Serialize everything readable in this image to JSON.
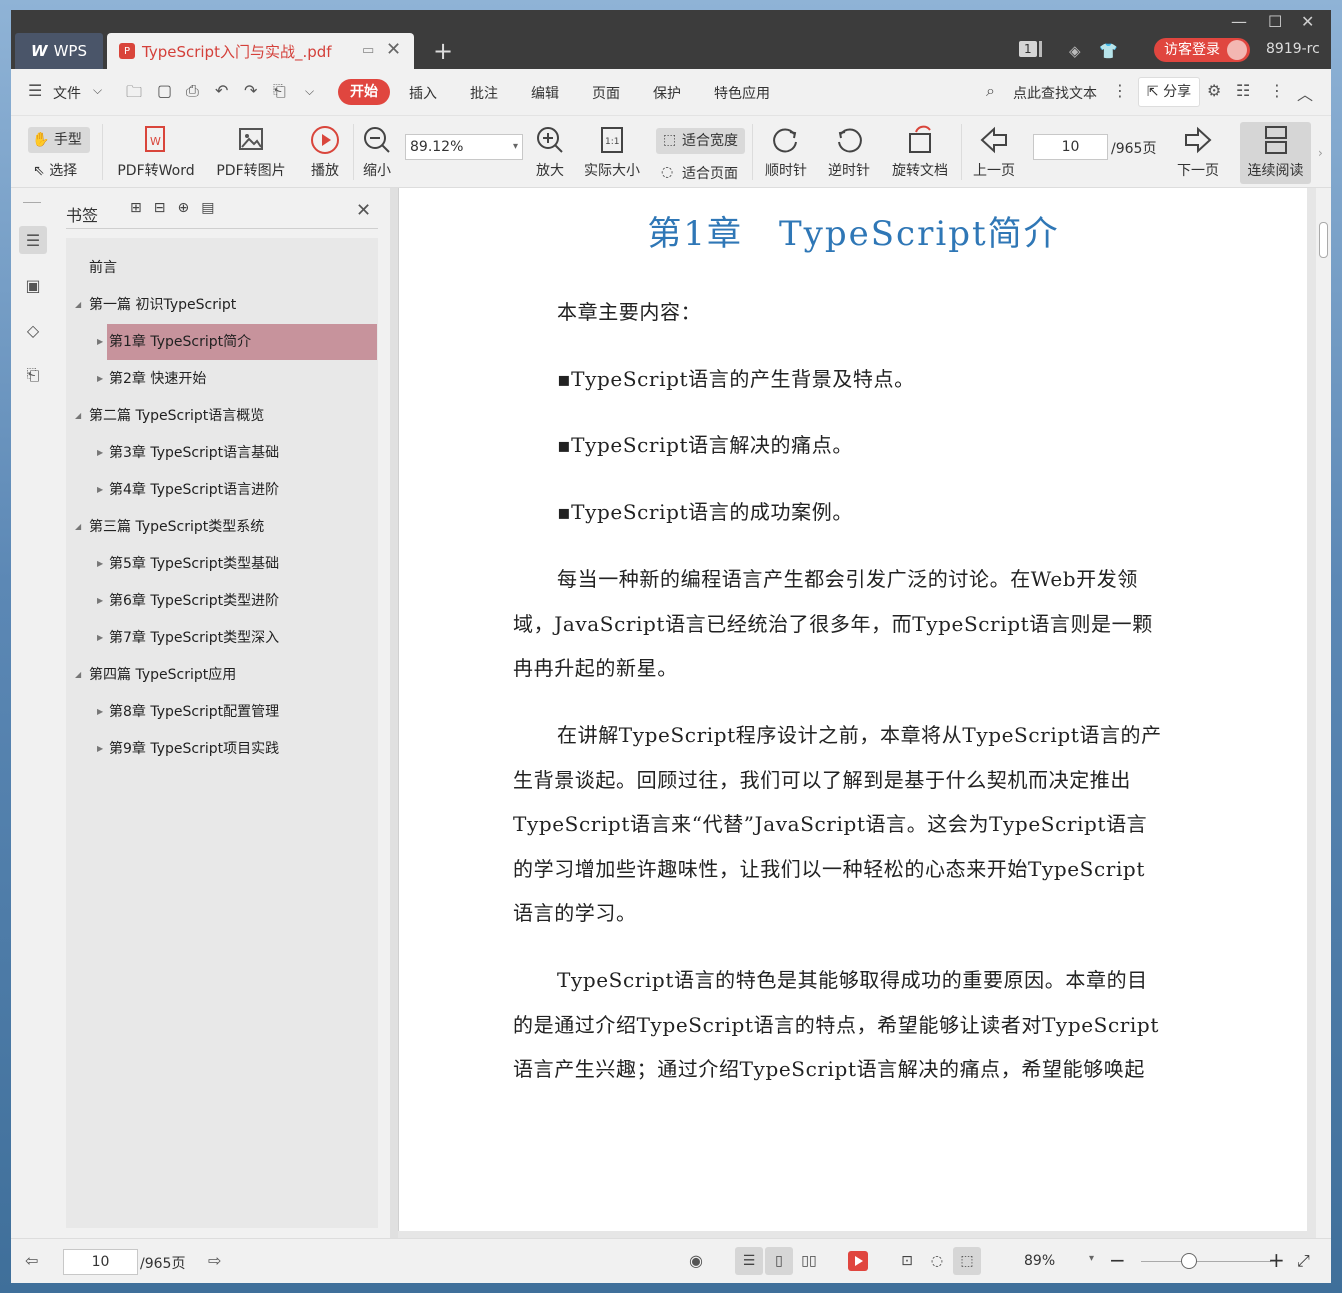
{
  "titlebar": {
    "app_tab": "WPS",
    "doc_tab": "TypeScript入门与实战_.pdf",
    "page_badge": "1",
    "login_label": "访客登录",
    "version": "8919-rc"
  },
  "menubar": {
    "file": "文件",
    "start": "开始",
    "insert": "插入",
    "comment": "批注",
    "edit": "编辑",
    "page": "页面",
    "protect": "保护",
    "special": "特色应用",
    "search": "点此查找文本",
    "share": "分享"
  },
  "toolbar": {
    "hand": "手型",
    "select": "选择",
    "pdf_to_word": "PDF转Word",
    "pdf_to_image": "PDF转图片",
    "play": "播放",
    "zoom_out": "缩小",
    "zoom_value": "89.12%",
    "zoom_in": "放大",
    "actual_size": "实际大小",
    "fit_width": "适合宽度",
    "fit_page": "适合页面",
    "clockwise": "顺时针",
    "counterclockwise": "逆时针",
    "rotate_doc": "旋转文档",
    "prev_page": "上一页",
    "page_value": "10",
    "page_total": "/965页",
    "next_page": "下一页",
    "continuous": "连续阅读"
  },
  "bookmarks": {
    "title": "书签",
    "items": [
      {
        "label": "前言"
      },
      {
        "label": "第一篇 初识TypeScript"
      },
      {
        "label": "第1章 TypeScript简介"
      },
      {
        "label": "第2章 快速开始"
      },
      {
        "label": "第二篇 TypeScript语言概览"
      },
      {
        "label": "第3章 TypeScript语言基础"
      },
      {
        "label": "第4章 TypeScript语言进阶"
      },
      {
        "label": "第三篇 TypeScript类型系统"
      },
      {
        "label": "第5章 TypeScript类型基础"
      },
      {
        "label": "第6章 TypeScript类型进阶"
      },
      {
        "label": "第7章 TypeScript类型深入"
      },
      {
        "label": "第四篇 TypeScript应用"
      },
      {
        "label": "第8章 TypeScript配置管理"
      },
      {
        "label": "第9章 TypeScript项目实践"
      }
    ]
  },
  "document": {
    "chapter_title": "第1章　TypeScript简介",
    "lines": [
      "本章主要内容：",
      "▪TypeScript语言的产生背景及特点。",
      "▪TypeScript语言解决的痛点。",
      "▪TypeScript语言的成功案例。",
      "每当一种新的编程语言产生都会引发广泛的讨论。在Web开发领",
      "域，JavaScript语言已经统治了很多年，而TypeScript语言则是一颗",
      "冉冉升起的新星。",
      "在讲解TypeScript程序设计之前，本章将从TypeScript语言的产",
      "生背景谈起。回顾过往，我们可以了解到是基于什么契机而决定推出",
      "TypeScript语言来“代替”JavaScript语言。这会为TypeScript语言",
      "的学习增加些许趣味性，让我们以一种轻松的心态来开始TypeScript",
      "语言的学习。",
      "TypeScript语言的特色是其能够取得成功的重要原因。本章的目",
      "的是通过介绍TypeScript语言的特点，希望能够让读者对TypeScript",
      "语言产生兴趣；通过介绍TypeScript语言解决的痛点，希望能够唤起"
    ]
  },
  "statusbar": {
    "page_value": "10",
    "page_total": "/965页",
    "zoom": "89%"
  }
}
